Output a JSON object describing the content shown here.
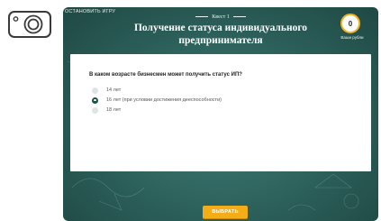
{
  "toolbar": {
    "camera_icon": "camera-icon"
  },
  "game": {
    "stop_label": "ОСТАНОВИТЬ ИГРУ",
    "quest_label": "Квест 1",
    "title": "Получение статуса индивидуального предпринимателя",
    "score": {
      "value": "0",
      "label": "Ваши рубли"
    },
    "question": "В каком возрасте бизнесмен может получить статус ИП?",
    "options": [
      {
        "label": "14 лет",
        "selected": false
      },
      {
        "label": "16 лет (при условии достижения дееспособности)",
        "selected": true
      },
      {
        "label": "18 лет",
        "selected": false
      }
    ],
    "choose_label": "ВЫБРАТЬ"
  },
  "colors": {
    "board_bg": "#2c5f5a",
    "accent_gold": "#f2ad17",
    "selected_radio": "#1e4f4a"
  }
}
